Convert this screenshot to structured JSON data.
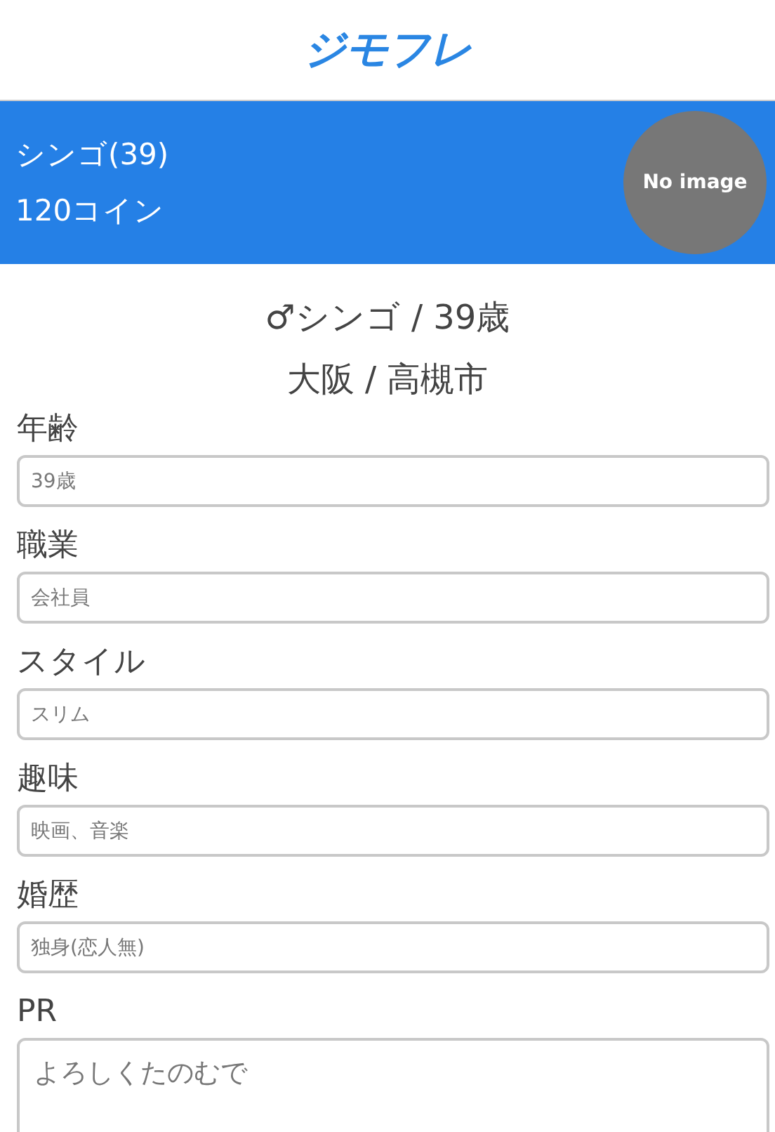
{
  "header": {
    "logo": "ジモフレ"
  },
  "profile_banner": {
    "name": "シンゴ(39)",
    "coins": "120コイン",
    "avatar_label": "No image"
  },
  "summary": {
    "title": "♂シンゴ / 39歳",
    "location": "大阪 / 高槻市"
  },
  "fields": [
    {
      "label": "年齢",
      "value": "39歳"
    },
    {
      "label": "職業",
      "value": "会社員"
    },
    {
      "label": "スタイル",
      "value": "スリム"
    },
    {
      "label": "趣味",
      "value": "映画、音楽"
    },
    {
      "label": "婚歴",
      "value": "独身(恋人無)"
    }
  ],
  "pr": {
    "label": "PR",
    "value": "よろしくたのむで"
  }
}
